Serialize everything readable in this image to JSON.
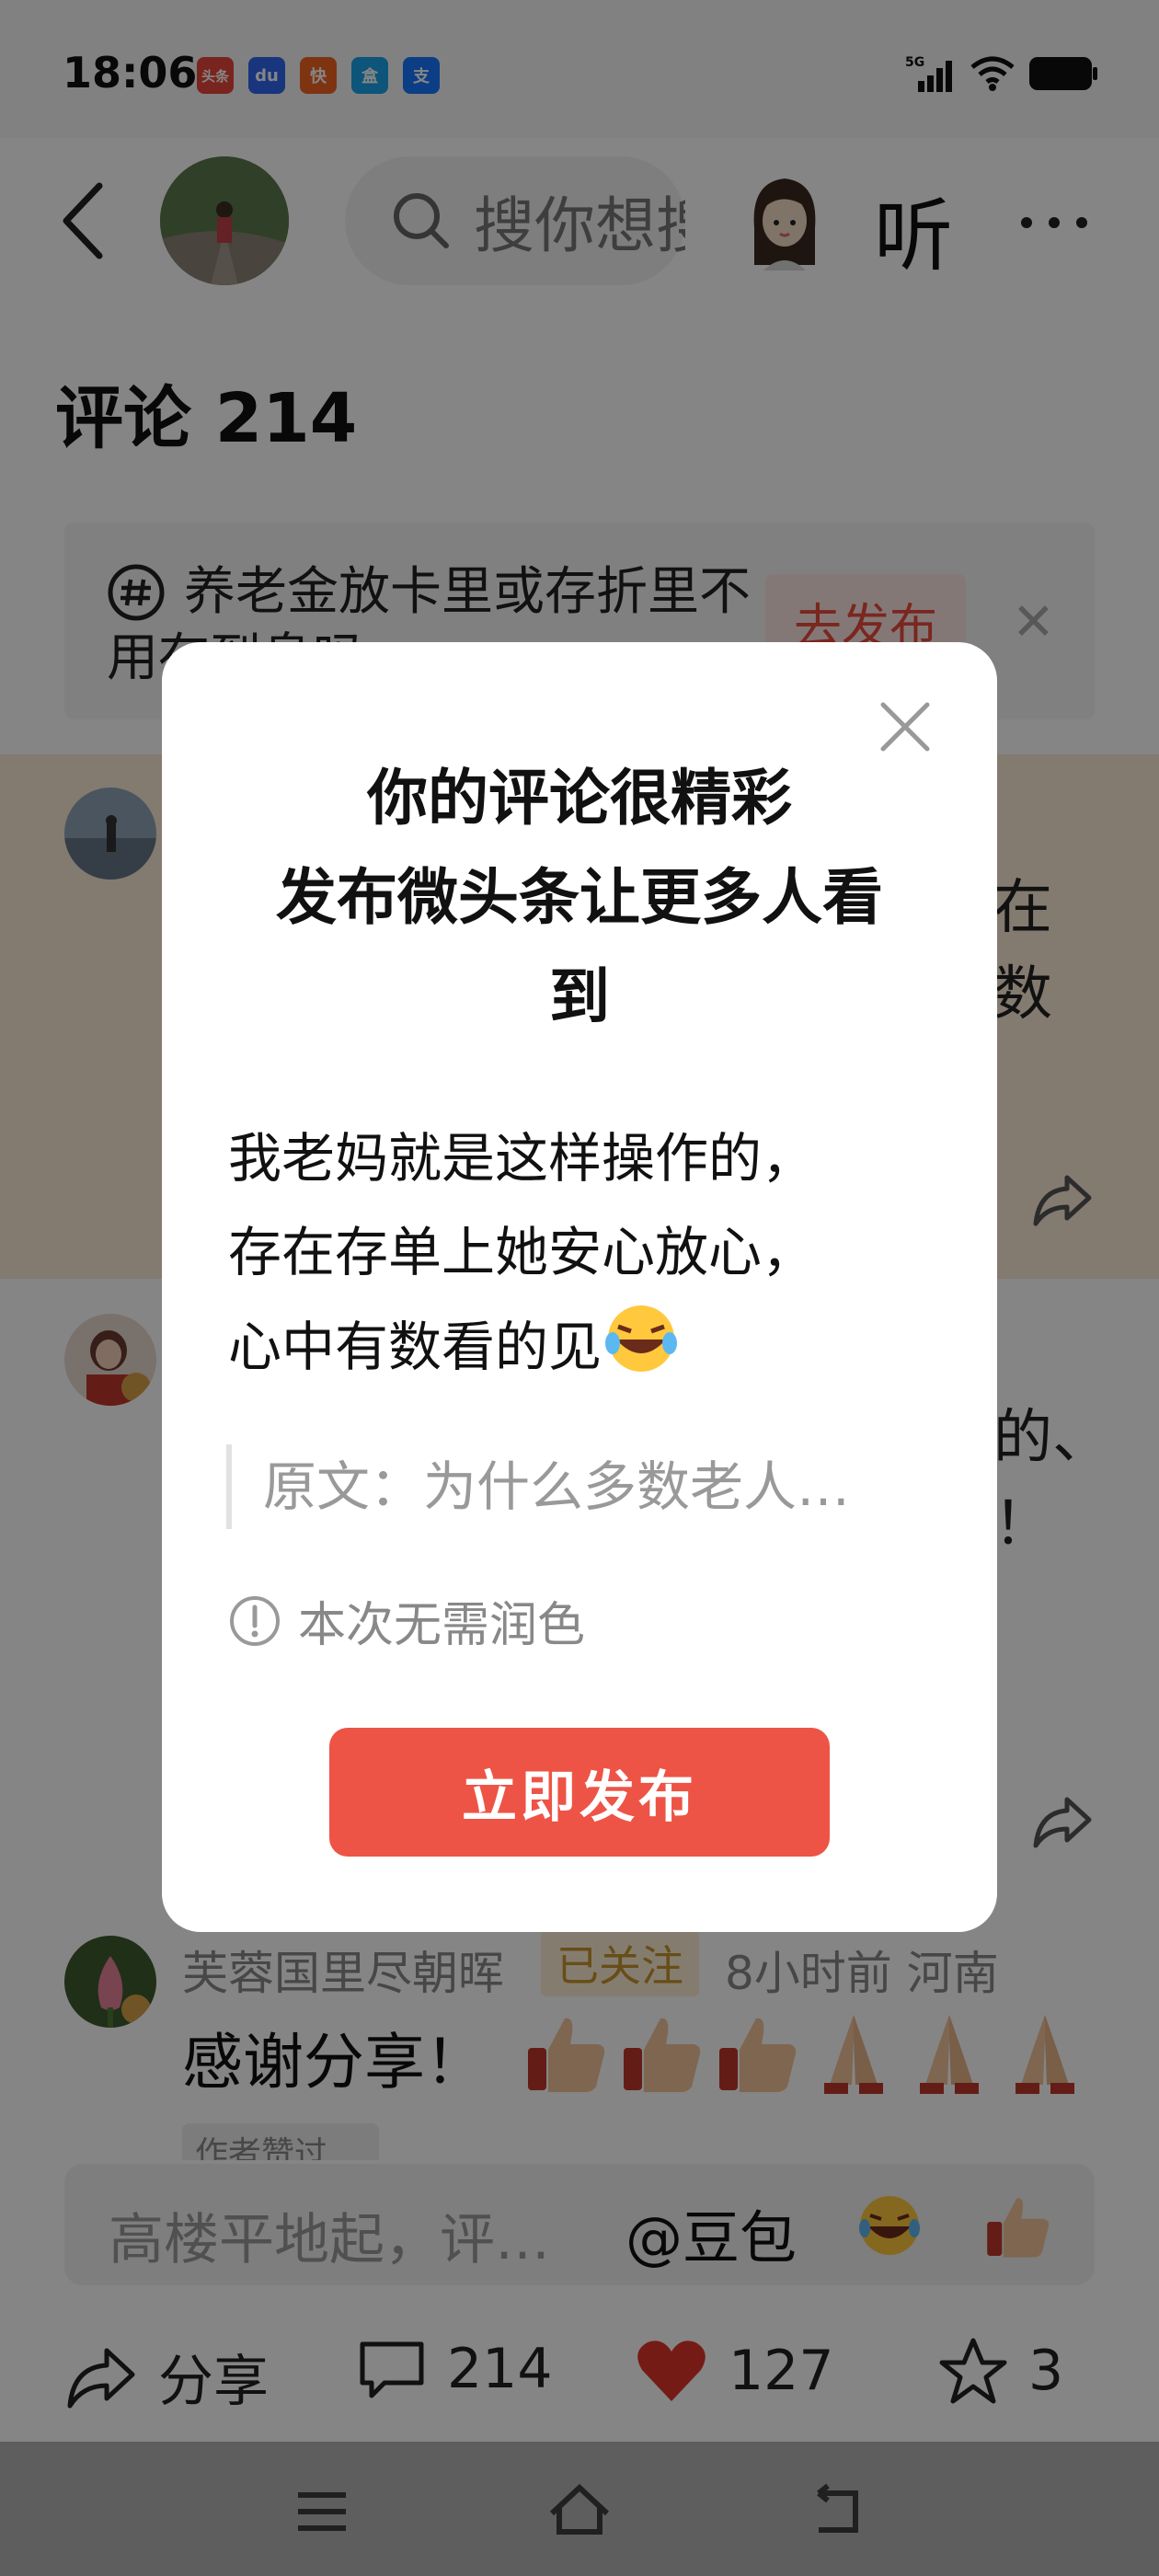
{
  "status_bar": {
    "time": "18:06",
    "apps": [
      "头条",
      "du",
      "快",
      "盒",
      "支"
    ],
    "network": "5G"
  },
  "header": {
    "search_placeholder": "搜你想搜",
    "listen_label": "听"
  },
  "comments_section": {
    "title": "评论 214",
    "topic_banner": {
      "text": "养老金放卡里或存折里不用存到息吗",
      "button": "去发布"
    },
    "peek_texts": {
      "c1_line1": "在",
      "c1_line2": "数",
      "c2_line1": "的、",
      "c2_line2": "！"
    },
    "third_comment": {
      "username": "芙蓉国里尽朝晖",
      "follow_badge": "已关注",
      "meta": "8小时前  河南",
      "text": "感谢分享！",
      "author_tag": "作者赞过"
    }
  },
  "input_bar": {
    "placeholder": "高楼平地起，评…",
    "mention": "@豆包"
  },
  "actions": {
    "share_label": "分享",
    "comment_count": "214",
    "like_count": "127",
    "star_count": "3"
  },
  "modal": {
    "title_line1": "你的评论很精彩",
    "title_line2": "发布微头条让更多人看",
    "title_line3": "到",
    "body_line1": "我老妈就是这样操作的，",
    "body_line2": "存在存单上她安心放心，",
    "body_line3": "心中有数看的见",
    "quote": "原文：为什么多数老人…",
    "hint": "本次无需润色",
    "publish_button": "立即发布"
  },
  "colors": {
    "accent_red": "#ed5446",
    "like_red": "#e0352b",
    "follow_gold": "#c8942d"
  }
}
